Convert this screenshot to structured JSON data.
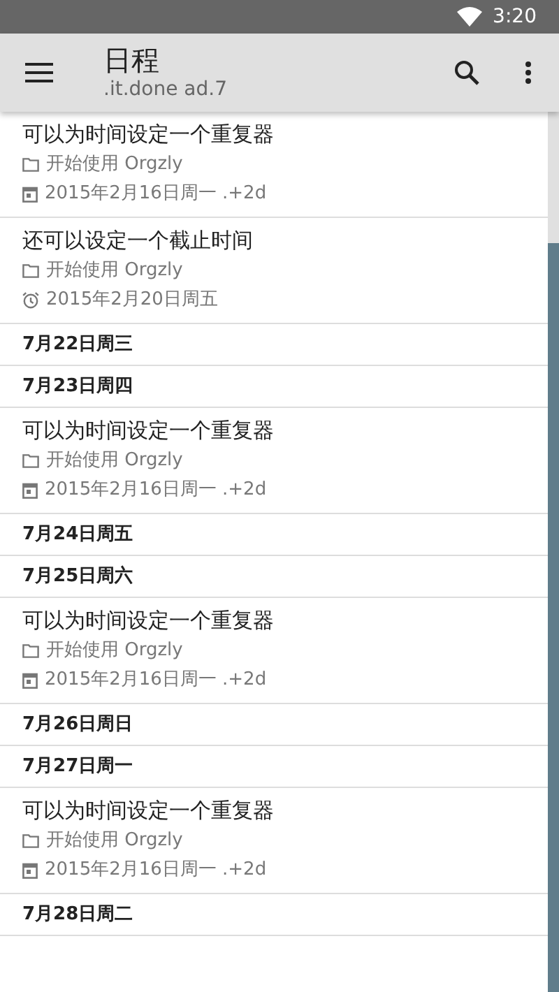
{
  "status_bar": {
    "time": "3:20"
  },
  "toolbar": {
    "title": "日程",
    "subtitle": ".it.done ad.7"
  },
  "items": [
    {
      "kind": "note",
      "title": "可以为时间设定一个重复器",
      "book": "开始使用 Orgzly",
      "time": {
        "kind": "scheduled",
        "text": "2015年2月16日周一 .+2d"
      }
    },
    {
      "kind": "note",
      "title": "还可以设定一个截止时间",
      "book": "开始使用 Orgzly",
      "time": {
        "kind": "deadline",
        "text": "2015年2月20日周五"
      }
    },
    {
      "kind": "day",
      "title": "7月22日周三"
    },
    {
      "kind": "day",
      "title": "7月23日周四"
    },
    {
      "kind": "note",
      "title": "可以为时间设定一个重复器",
      "book": "开始使用 Orgzly",
      "time": {
        "kind": "scheduled",
        "text": "2015年2月16日周一 .+2d"
      }
    },
    {
      "kind": "day",
      "title": "7月24日周五"
    },
    {
      "kind": "day",
      "title": "7月25日周六"
    },
    {
      "kind": "note",
      "title": "可以为时间设定一个重复器",
      "book": "开始使用 Orgzly",
      "time": {
        "kind": "scheduled",
        "text": "2015年2月16日周一 .+2d"
      }
    },
    {
      "kind": "day",
      "title": "7月26日周日"
    },
    {
      "kind": "day",
      "title": "7月27日周一"
    },
    {
      "kind": "note",
      "title": "可以为时间设定一个重复器",
      "book": "开始使用 Orgzly",
      "time": {
        "kind": "scheduled",
        "text": "2015年2月16日周一 .+2d"
      }
    },
    {
      "kind": "day",
      "title": "7月28日周二"
    }
  ]
}
